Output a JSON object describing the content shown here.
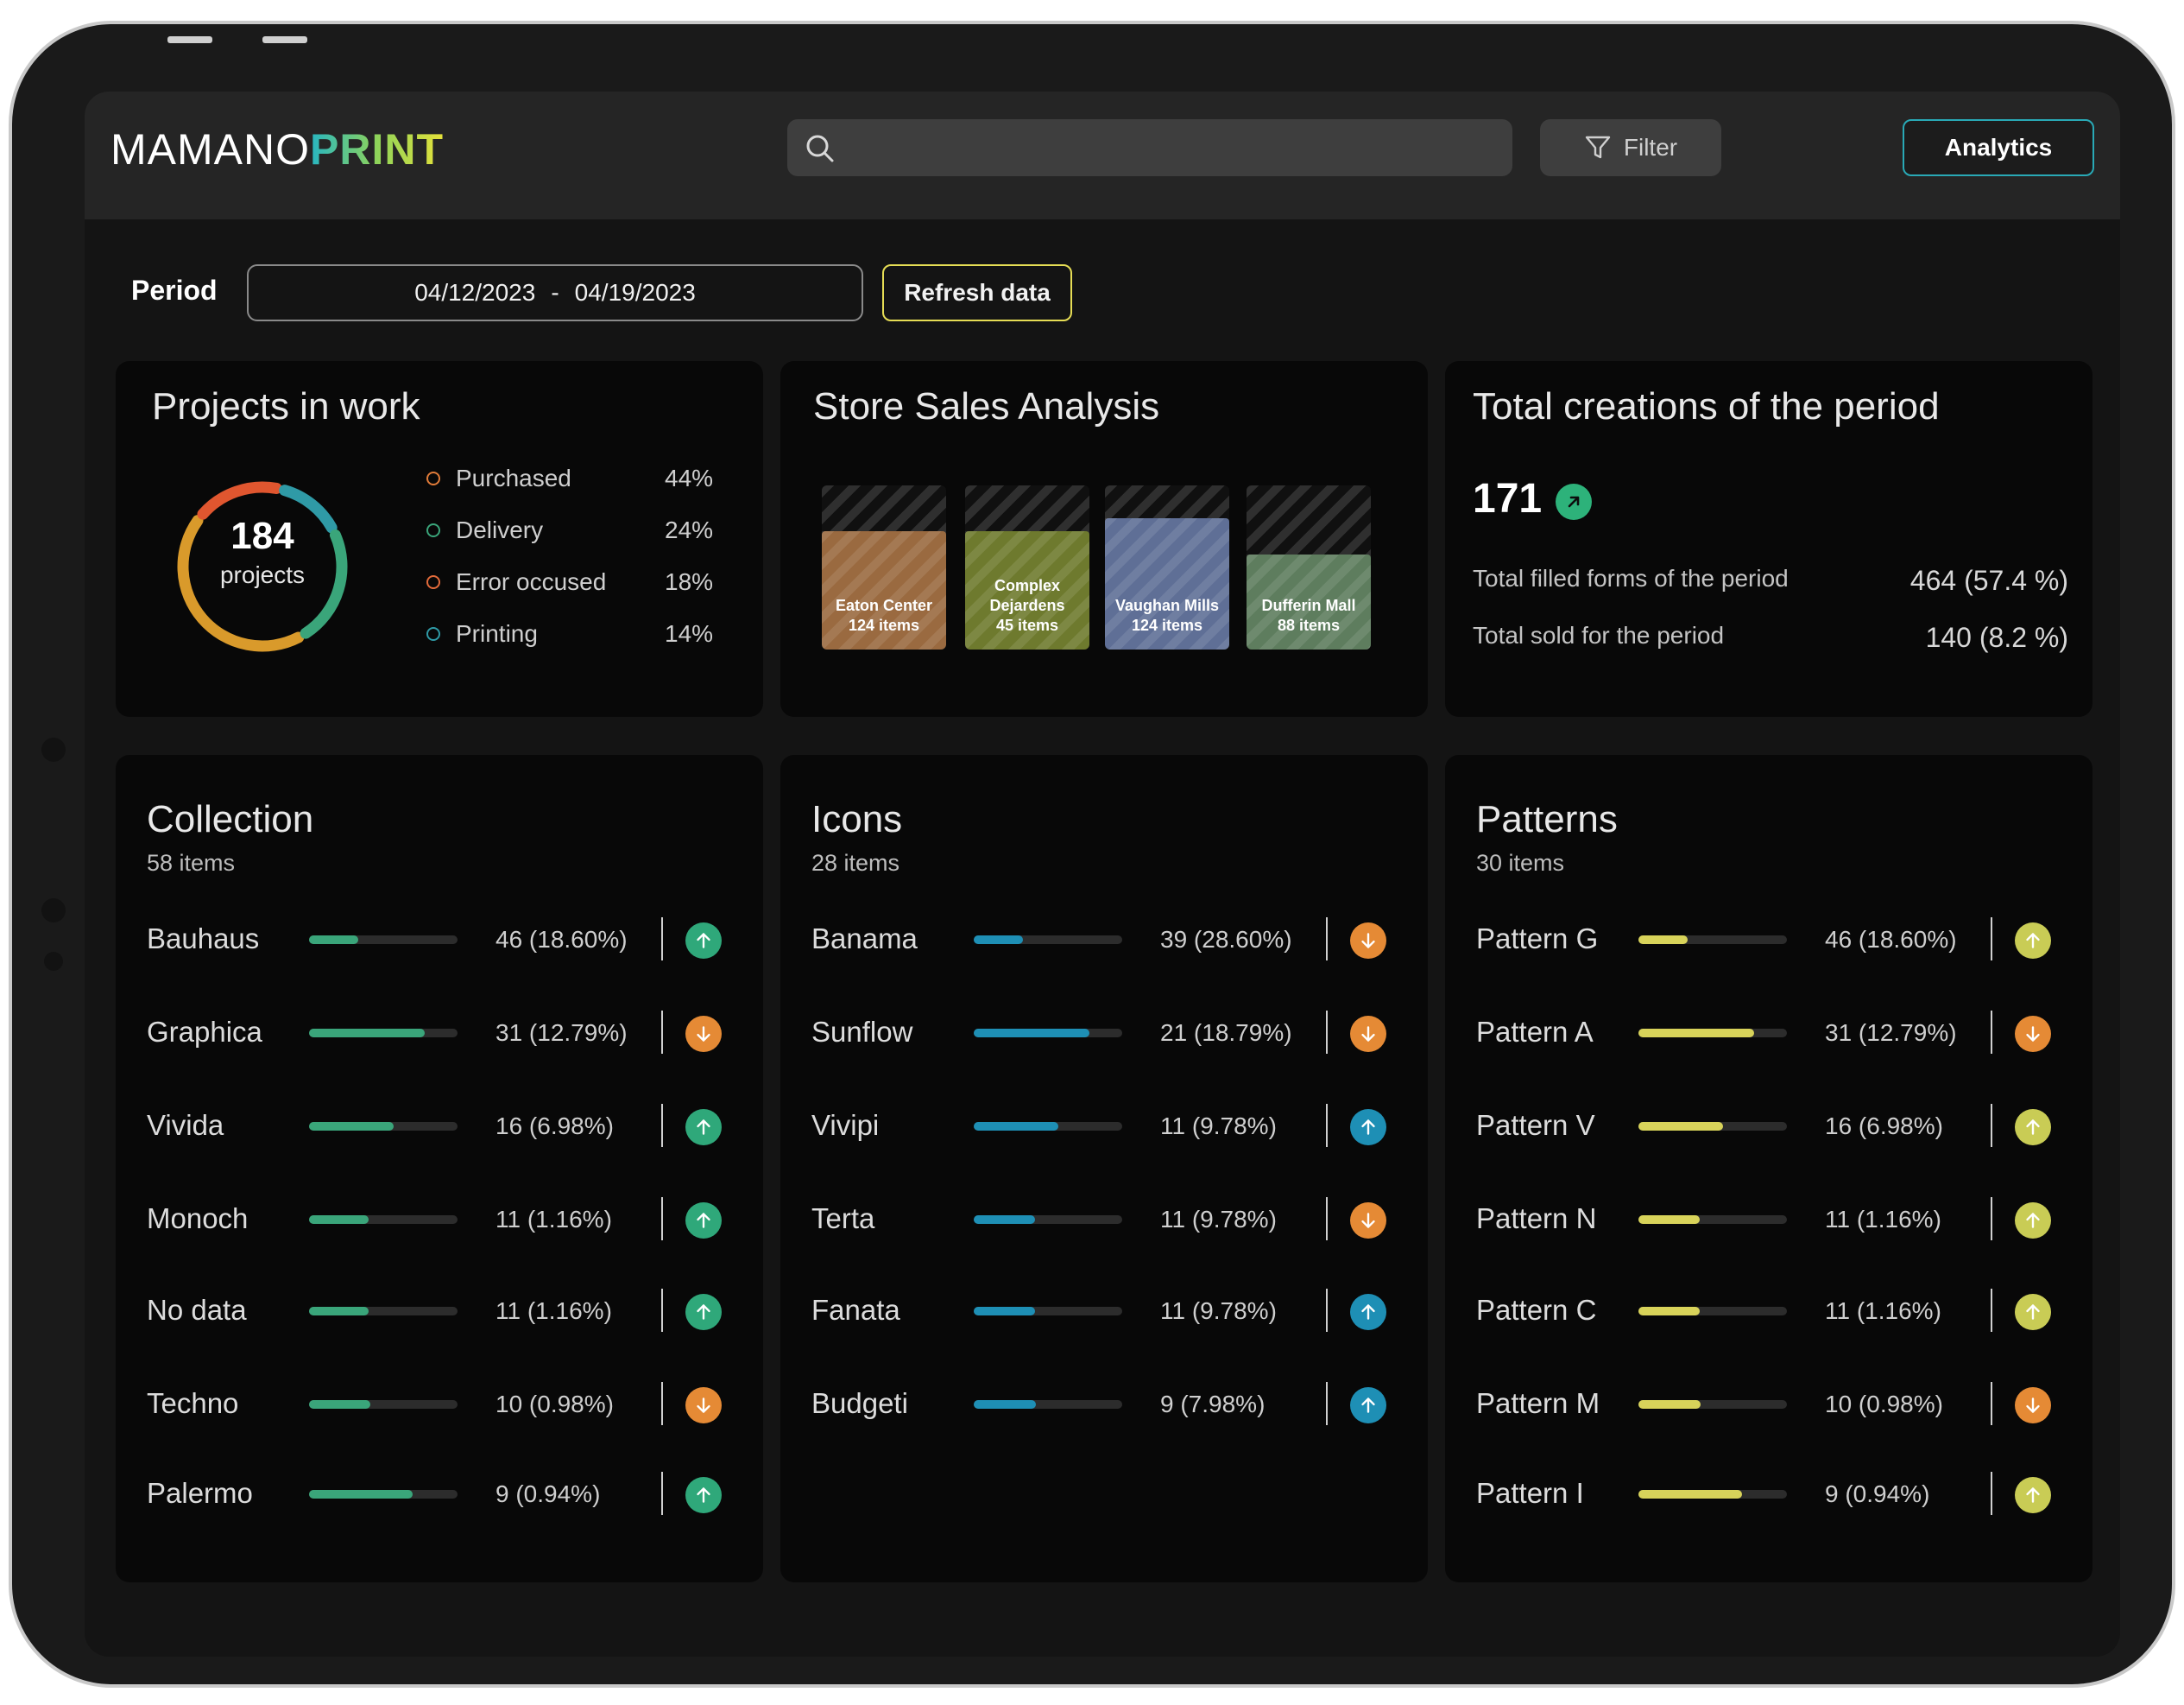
{
  "header": {
    "logo_part1": "MAMANO",
    "logo_part2": "PRINT",
    "search_placeholder": "",
    "filter_label": "Filter",
    "analytics_label": "Analytics"
  },
  "period": {
    "label": "Period",
    "start": "04/12/2023",
    "separator": "-",
    "end": "04/19/2023",
    "refresh_label": "Refresh data"
  },
  "projects": {
    "title": "Projects in work",
    "count": "184",
    "count_label": "projects",
    "legend": [
      {
        "label": "Purchased",
        "pct": "44%",
        "value": 44,
        "color": "#e07b39"
      },
      {
        "label": "Delivery",
        "pct": "24%",
        "value": 24,
        "color": "#3aa57a"
      },
      {
        "label": "Error occused",
        "pct": "18%",
        "value": 18,
        "color": "#e36b3b"
      },
      {
        "label": "Printing",
        "pct": "14%",
        "value": 14,
        "color": "#2f9aa6"
      }
    ]
  },
  "store_sales": {
    "title": "Store Sales Analysis",
    "stores": [
      {
        "name": "Eaton Center",
        "items": "124 items",
        "color": "#9a6a40",
        "fill": 0.72
      },
      {
        "name": "Complex Dejardens",
        "items": "45 items",
        "color": "#6e7a2e",
        "fill": 0.72
      },
      {
        "name": "Vaughan Mills",
        "items": "124 items",
        "color": "#5f6f96",
        "fill": 0.8
      },
      {
        "name": "Dufferin Mall",
        "items": "88 items",
        "color": "#5e7d5e",
        "fill": 0.58
      }
    ]
  },
  "totals": {
    "title": "Total creations of the period",
    "count": "171",
    "rows": [
      {
        "label": "Total filled forms of the period",
        "value": "464 (57.4 %)"
      },
      {
        "label": "Total sold for the period",
        "value": "140 (8.2 %)"
      }
    ]
  },
  "collection": {
    "title": "Collection",
    "subtitle": "58 items",
    "bar_color": "#3aa57a",
    "items": [
      {
        "name": "Bauhaus",
        "value": "46 (18.60%)",
        "fill": 0.33,
        "trend": "up",
        "trend_color": "#2fa87a"
      },
      {
        "name": "Graphica",
        "value": "31 (12.79%)",
        "fill": 0.78,
        "trend": "down",
        "trend_color": "#e58a35"
      },
      {
        "name": "Vivida",
        "value": "16 (6.98%)",
        "fill": 0.57,
        "trend": "up",
        "trend_color": "#2fa87a"
      },
      {
        "name": "Monoch",
        "value": "11 (1.16%)",
        "fill": 0.4,
        "trend": "up",
        "trend_color": "#2fa87a"
      },
      {
        "name": "No data",
        "value": "11 (1.16%)",
        "fill": 0.4,
        "trend": "up",
        "trend_color": "#2fa87a"
      },
      {
        "name": "Techno",
        "value": "10 (0.98%)",
        "fill": 0.41,
        "trend": "down",
        "trend_color": "#e58a35"
      },
      {
        "name": "Palermo",
        "value": "9 (0.94%)",
        "fill": 0.7,
        "trend": "up",
        "trend_color": "#2fa87a"
      }
    ]
  },
  "icons": {
    "title": "Icons",
    "subtitle": "28 items",
    "bar_color": "#1e8fb5",
    "items": [
      {
        "name": "Banama",
        "value": "39 (28.60%)",
        "fill": 0.33,
        "trend": "down",
        "trend_color": "#e58a35"
      },
      {
        "name": "Sunflow",
        "value": "21 (18.79%)",
        "fill": 0.78,
        "trend": "down",
        "trend_color": "#e58a35"
      },
      {
        "name": "Vivipi",
        "value": "11 (9.78%)",
        "fill": 0.57,
        "trend": "up",
        "trend_color": "#1e8fb5"
      },
      {
        "name": "Terta",
        "value": "11 (9.78%)",
        "fill": 0.41,
        "trend": "down",
        "trend_color": "#e58a35"
      },
      {
        "name": "Fanata",
        "value": "11 (9.78%)",
        "fill": 0.41,
        "trend": "up",
        "trend_color": "#1e8fb5"
      },
      {
        "name": "Budgeti",
        "value": "9 (7.98%)",
        "fill": 0.42,
        "trend": "up",
        "trend_color": "#1e8fb5"
      }
    ]
  },
  "patterns": {
    "title": "Patterns",
    "subtitle": "30 items",
    "bar_color": "#d8d35a",
    "items": [
      {
        "name": "Pattern G",
        "value": "46 (18.60%)",
        "fill": 0.33,
        "trend": "up",
        "trend_color": "#c9cc55"
      },
      {
        "name": "Pattern A",
        "value": "31 (12.79%)",
        "fill": 0.78,
        "trend": "down",
        "trend_color": "#e58a35"
      },
      {
        "name": "Pattern V",
        "value": "16 (6.98%)",
        "fill": 0.57,
        "trend": "up",
        "trend_color": "#c9cc55"
      },
      {
        "name": "Pattern N",
        "value": "11 (1.16%)",
        "fill": 0.41,
        "trend": "up",
        "trend_color": "#c9cc55"
      },
      {
        "name": "Pattern C",
        "value": "11 (1.16%)",
        "fill": 0.41,
        "trend": "up",
        "trend_color": "#c9cc55"
      },
      {
        "name": "Pattern M",
        "value": "10 (0.98%)",
        "fill": 0.42,
        "trend": "down",
        "trend_color": "#e58a35"
      },
      {
        "name": "Pattern I",
        "value": "9 (0.94%)",
        "fill": 0.7,
        "trend": "up",
        "trend_color": "#c9cc55"
      }
    ]
  }
}
